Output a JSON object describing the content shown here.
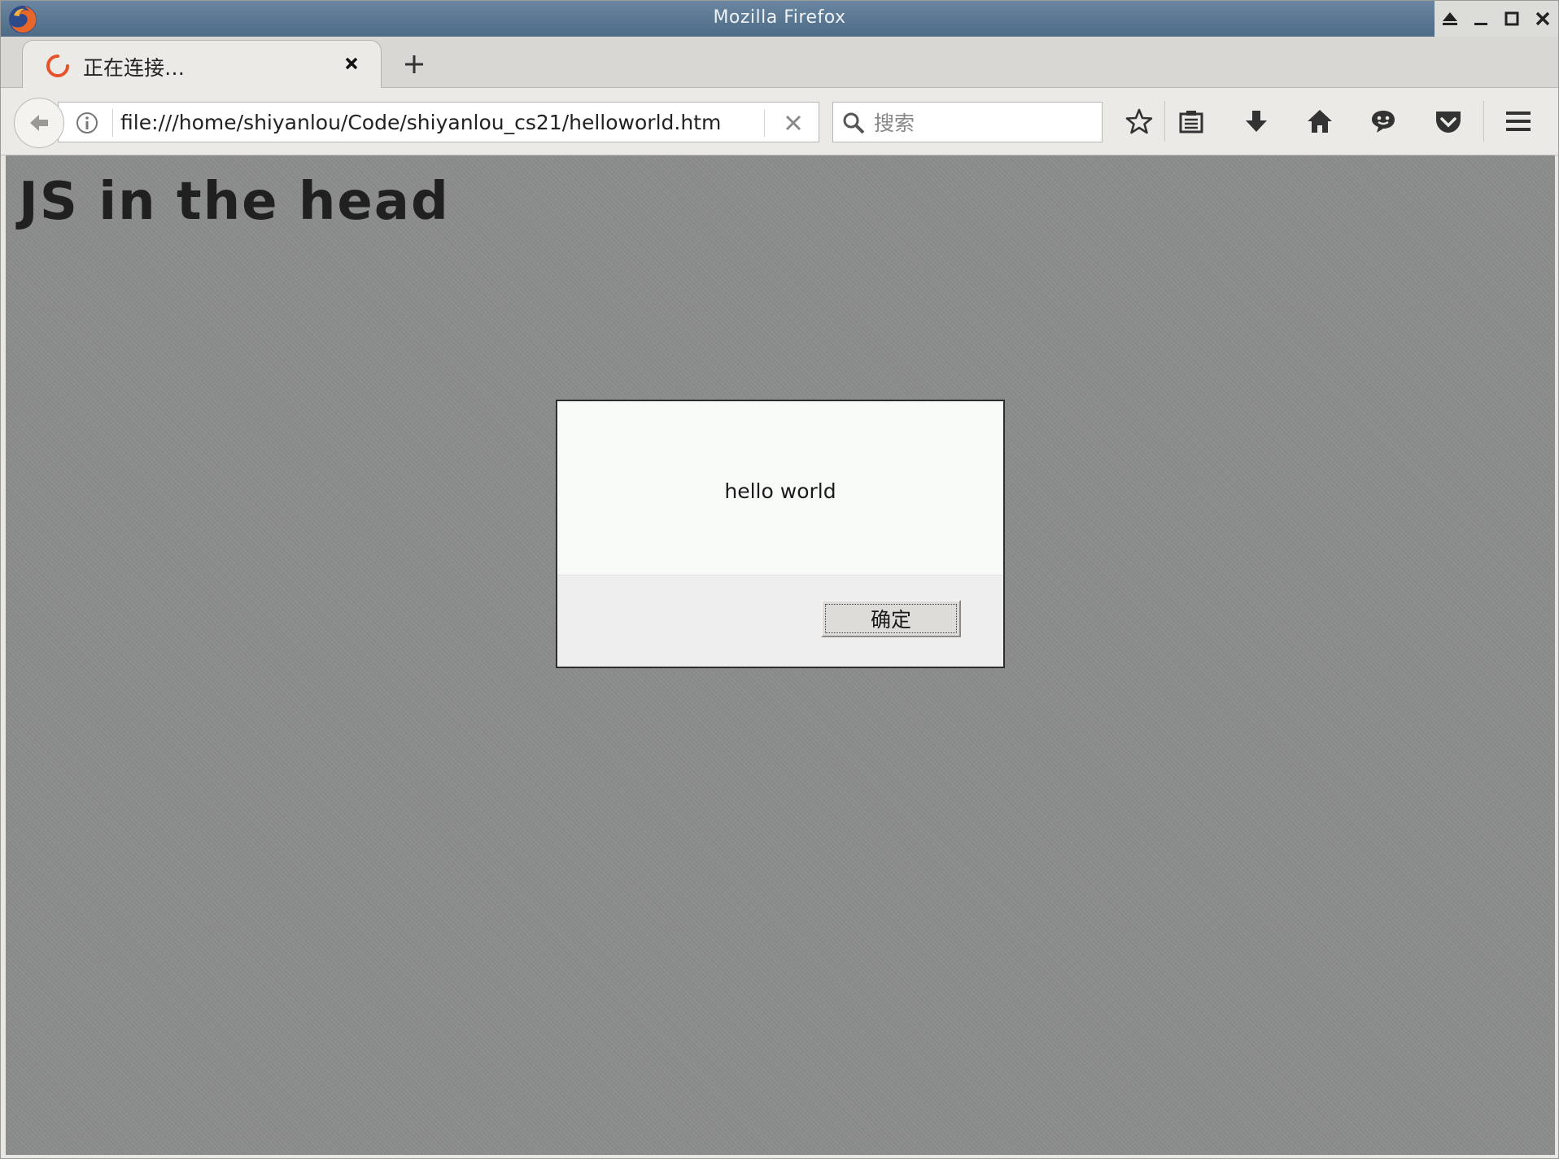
{
  "window": {
    "title": "Mozilla Firefox"
  },
  "tabs": [
    {
      "label": "正在连接…",
      "loading": true
    }
  ],
  "navbar": {
    "url": "file:///home/shiyanlou/Code/shiyanlou_cs21/helloworld.htm",
    "search_placeholder": "搜索"
  },
  "toolbar": {
    "icons": [
      "bookmark-star-icon",
      "reading-list-icon",
      "download-icon",
      "home-icon",
      "chat-icon",
      "pocket-icon",
      "hamburger-menu-icon"
    ]
  },
  "page": {
    "heading": "JS in the head"
  },
  "alert": {
    "message": "hello world",
    "ok_label": "确定"
  },
  "colors": {
    "titlebar": "#5a7793",
    "content_background": "#8b8c8c",
    "throbber": "#e8522a"
  }
}
